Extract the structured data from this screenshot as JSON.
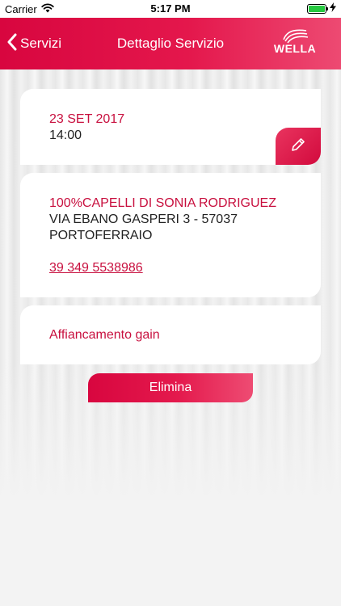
{
  "status_bar": {
    "carrier": "Carrier",
    "time": "5:17 PM",
    "icons": [
      "wifi-icon",
      "battery-icon",
      "charging-bolt-icon"
    ]
  },
  "nav": {
    "back_label": "Servizi",
    "title": "Dettaglio Servizio",
    "logo_text": "WELLA"
  },
  "appointment": {
    "date": "23 SET 2017",
    "time": "14:00",
    "edit_icon": "pencil-icon"
  },
  "salon": {
    "name": "100%CAPELLI DI SONIA RODRIGUEZ",
    "address_line1": "VIA EBANO GASPERI 3 - 57037",
    "address_line2": "PORTOFERRAIO",
    "phone": "39 349 5538986"
  },
  "service": {
    "name": "Affiancamento gain"
  },
  "actions": {
    "delete_label": "Elimina"
  },
  "colors": {
    "accent": "#d8063f",
    "accent_text": "#c8103f",
    "background": "#f1f1f1"
  }
}
